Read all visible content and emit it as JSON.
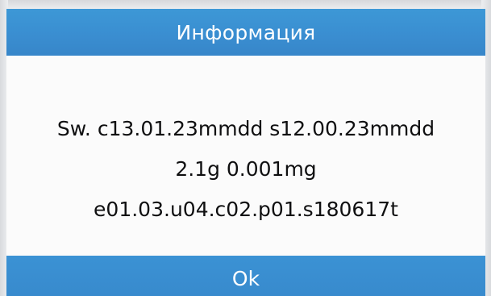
{
  "dialog": {
    "title": "Информация",
    "lines": [
      "Sw. c13.01.23mmdd s12.00.23mmdd",
      "2.1g 0.001mg",
      "e01.03.u04.c02.p01.s180617t"
    ],
    "ok_label": "Ok"
  },
  "colors": {
    "title_bar": "#3a8ed1",
    "ok_bar": "#388acd",
    "body_background": "#fbfbfb",
    "text": "#0f0f10"
  }
}
